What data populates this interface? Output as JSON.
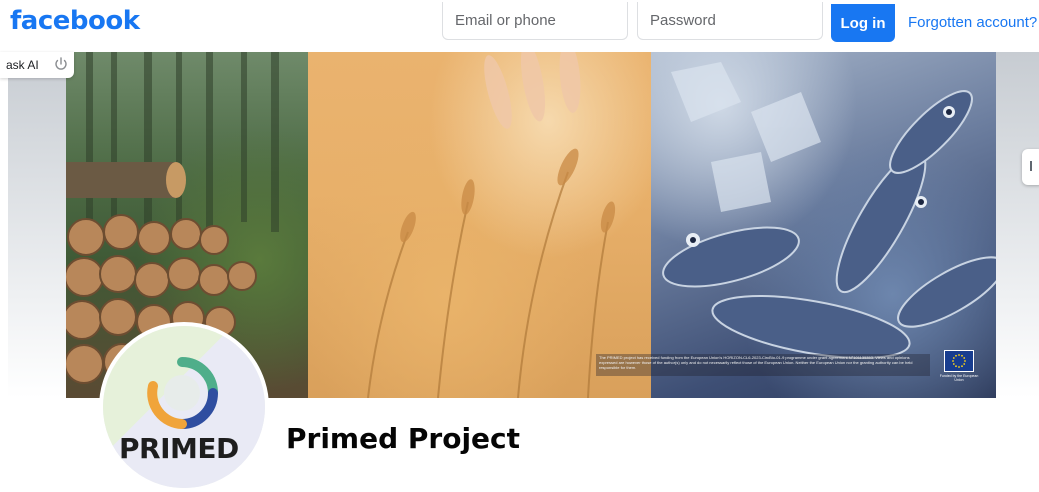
{
  "header": {
    "brand": "facebook",
    "email_placeholder": "Email or phone",
    "password_placeholder": "Password",
    "login_label": "Log in",
    "forgot_label": "Forgotten account?"
  },
  "askai": {
    "label": "ask AI"
  },
  "cover": {
    "funding_text": "The PRIMED project has received funding from the European Union's HORIZON-CL6-2023-CircBio-01-9 programme under grant agreement N°101135353. Views and opinions expressed are however those of the author(s) only and do not necessarily reflect those of the European Union. Neither the European Union nor the granting authority can be held responsible for them.",
    "eu_caption": "Funded by the European Union"
  },
  "profile": {
    "logo_text": "PRIMED",
    "page_name": "Primed Project"
  },
  "colors": {
    "brand_blue": "#1877f2",
    "ring_green": "#4fae8a",
    "ring_blue": "#2f4ea0",
    "ring_orange": "#f0a43a"
  }
}
